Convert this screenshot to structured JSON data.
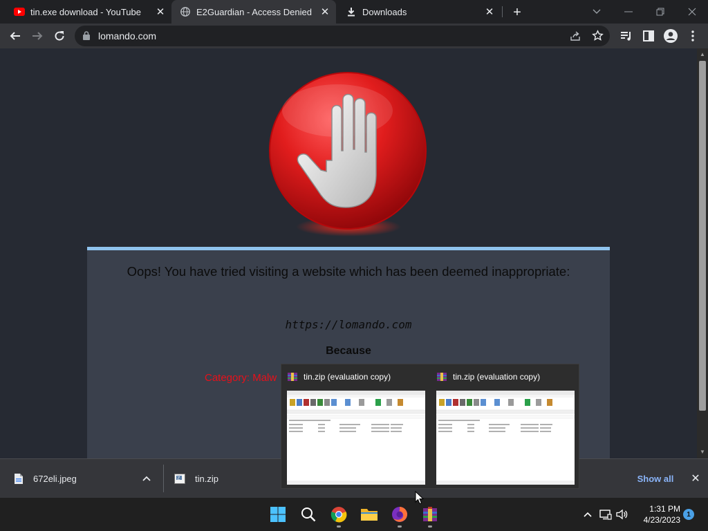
{
  "browser": {
    "tabs": [
      {
        "title": "tin.exe download - YouTube",
        "icon": "youtube-icon"
      },
      {
        "title": "E2Guardian - Access Denied",
        "icon": "globe-icon"
      },
      {
        "title": "Downloads",
        "icon": "download-icon"
      }
    ],
    "active_tab": 1,
    "url": "lomando.com"
  },
  "page": {
    "message": "Oops! You have tried visiting a website which has been deemed inappropriate:",
    "blocked_url": "https://lomando.com",
    "because": "Because",
    "category": "Category: Malw"
  },
  "downloads": {
    "items": [
      {
        "name": "672eli.jpeg",
        "icon": "document-icon"
      },
      {
        "name": "tin.zip",
        "icon": "archive-icon"
      }
    ],
    "show_all_label": "Show all"
  },
  "thumbnails": [
    {
      "title": "tin.zip (evaluation copy)"
    },
    {
      "title": "tin.zip (evaluation copy)"
    }
  ],
  "taskbar": {
    "time": "1:31 PM",
    "date": "4/23/2023",
    "notification_count": "1"
  },
  "colors": {
    "accent": "#8ab4f8",
    "panel_bar": "#8fc3ee",
    "category_red": "#e8101a",
    "stop_red": "#d7141a"
  }
}
